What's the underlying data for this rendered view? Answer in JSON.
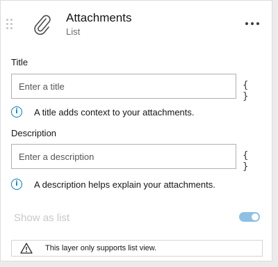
{
  "header": {
    "title": "Attachments",
    "subtitle": "List"
  },
  "title_field": {
    "label": "Title",
    "placeholder": "Enter a title",
    "value": "",
    "expression_label": "{ }",
    "hint": "A title adds context to your attachments."
  },
  "description_field": {
    "label": "Description",
    "placeholder": "Enter a description",
    "value": "",
    "expression_label": "{ }",
    "hint": "A description helps explain your attachments."
  },
  "show_as_list": {
    "label": "Show as list",
    "checked": true,
    "disabled": true
  },
  "notice": {
    "text": "This layer only supports list view."
  },
  "icons": {
    "drag": "drag-handle-icon",
    "header": "paperclip-icon",
    "more": "more-horizontal-icon",
    "info": "info-icon",
    "warning": "warning-icon"
  },
  "colors": {
    "accent": "#007ac2",
    "toggle_disabled": "#8ec0e3",
    "disabled_text": "#c8c8c8"
  }
}
